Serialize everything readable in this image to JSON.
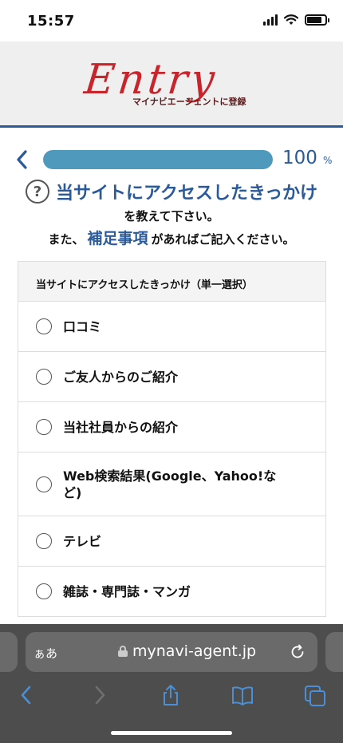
{
  "status_bar": {
    "time": "15:57"
  },
  "header": {
    "logo_text": "Entry",
    "logo_subtitle": "マイナビエージェントに登録"
  },
  "progress": {
    "value": "100",
    "unit": "%",
    "fraction": 1.0
  },
  "question": {
    "title": "当サイトにアクセスしたきっかけ",
    "line2": "を教えて下さい。",
    "line3_prefix": "また、",
    "line3_accent": "補足事項",
    "line3_suffix": "があればご記入ください。"
  },
  "options_card": {
    "header": "当サイトにアクセスしたきっかけ（単一選択）",
    "options": [
      {
        "label": "口コミ"
      },
      {
        "label": "ご友人からのご紹介"
      },
      {
        "label": "当社社員からの紹介"
      },
      {
        "label": "Web検索結果(Google、Yahoo!など)"
      },
      {
        "label": "テレビ"
      },
      {
        "label": "雑誌・専門誌・マンガ"
      }
    ]
  },
  "browser": {
    "aa_label": "ぁあ",
    "url": "mynavi-agent.jp"
  },
  "colors": {
    "accent_blue": "#2a5a9a",
    "progress_fill": "#4f99bd",
    "logo_red": "#c8242c"
  }
}
